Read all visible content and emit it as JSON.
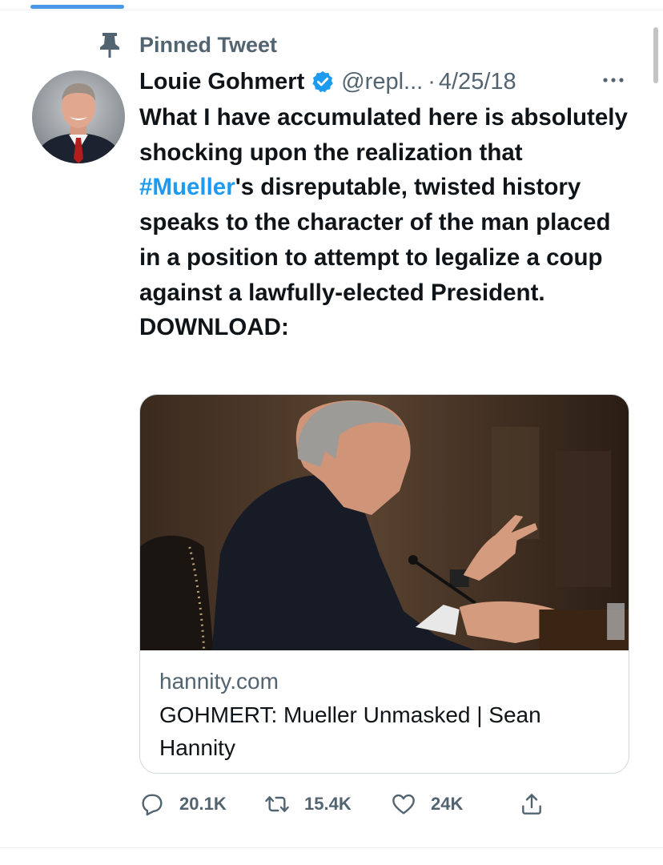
{
  "pinned_label": "Pinned Tweet",
  "author": {
    "name": "Louie Gohmert",
    "handle": "@repl...",
    "verified": true
  },
  "separator": "·",
  "date": "4/25/18",
  "tweet": {
    "text_before": "What I have accumulated here is absolutely shocking upon the realization that ",
    "hashtag": "#Mueller",
    "text_after": "'s disreputable, twisted history speaks to the character of the man placed in a position to attempt to legalize a coup against a lawfully-elected President. DOWNLOAD:"
  },
  "card": {
    "domain": "hannity.com",
    "title": "GOHMERT: Mueller Unmasked | Sean Hannity"
  },
  "actions": {
    "replies": "20.1K",
    "retweets": "15.4K",
    "likes": "24K"
  },
  "icons": {
    "pin": "pin-icon",
    "verified": "verified-badge-icon",
    "more": "more-options-icon",
    "reply": "reply-icon",
    "retweet": "retweet-icon",
    "like": "heart-icon",
    "share": "share-icon"
  },
  "colors": {
    "accent": "#1d9bf0",
    "tab_indicator": "#4a99e9",
    "secondary_text": "#536471",
    "primary_text": "#0f1419",
    "border": "#cfd9de"
  }
}
